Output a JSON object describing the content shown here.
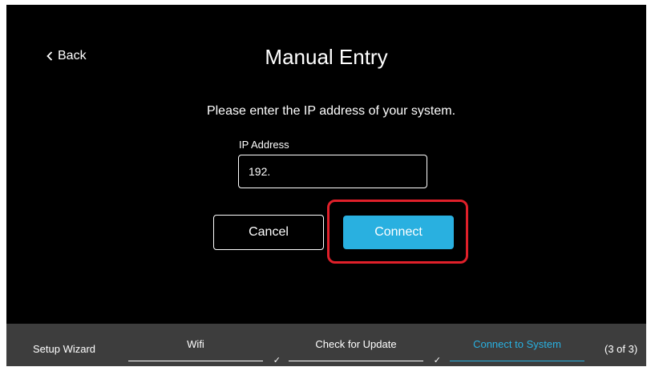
{
  "header": {
    "back_label": "Back",
    "title": "Manual Entry"
  },
  "form": {
    "instruction": "Please enter the IP address of your system.",
    "ip_label": "IP Address",
    "ip_value": "192."
  },
  "actions": {
    "cancel_label": "Cancel",
    "connect_label": "Connect"
  },
  "footer": {
    "wizard_label": "Setup Wizard",
    "steps": [
      {
        "label": "Wifi",
        "status": "complete"
      },
      {
        "label": "Check for Update",
        "status": "complete"
      },
      {
        "label": "Connect to System",
        "status": "active"
      }
    ],
    "step_count": "(3 of 3)"
  },
  "colors": {
    "accent": "#29b0e0",
    "highlight": "#e0202a",
    "footer_bg": "#3d3d3d",
    "screen_bg": "#000000"
  },
  "icons": {
    "back": "chevron-left-icon",
    "step_done": "checkmark-icon"
  }
}
